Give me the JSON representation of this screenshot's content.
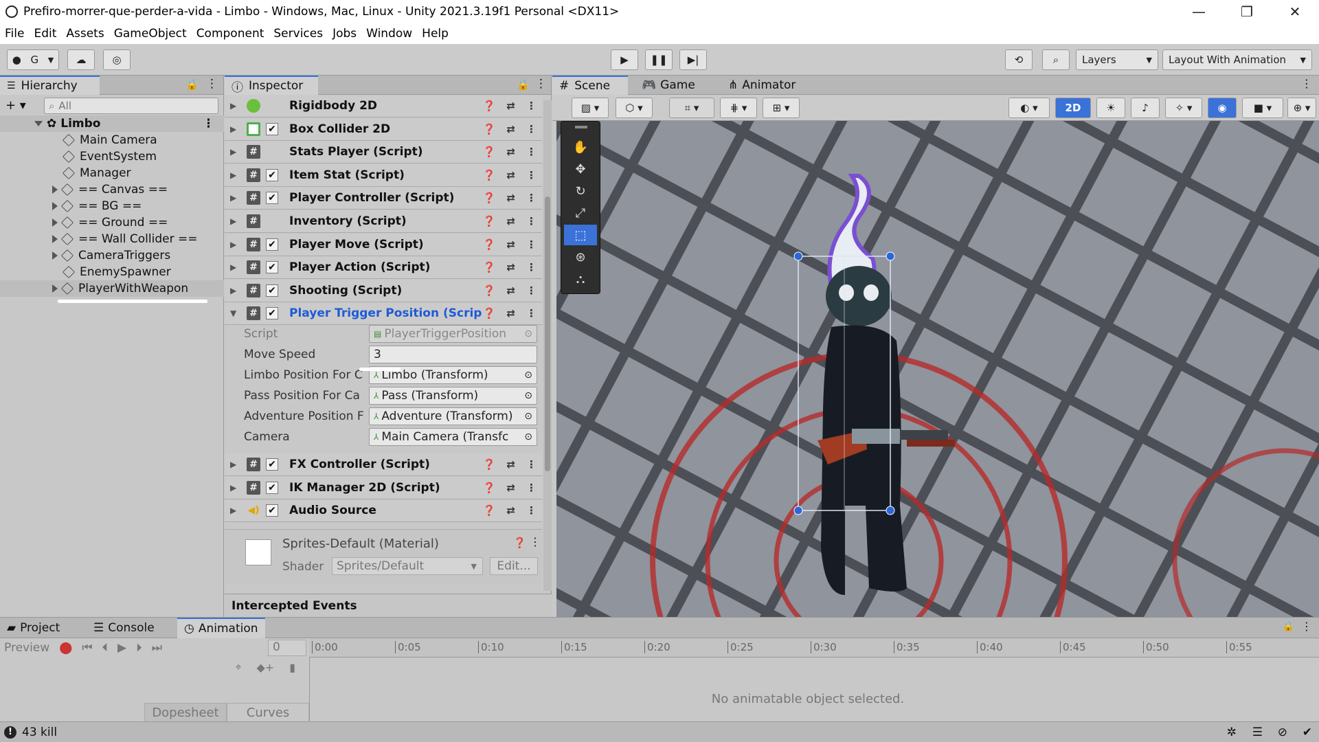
{
  "window": {
    "title": "Prefiro-morrer-que-perder-a-vida - Limbo - Windows, Mac, Linux - Unity 2021.3.19f1 Personal <DX11>",
    "controls": [
      "—",
      "❐",
      "✕"
    ]
  },
  "menu": [
    "File",
    "Edit",
    "Assets",
    "GameObject",
    "Component",
    "Services",
    "Jobs",
    "Window",
    "Help"
  ],
  "toolbar": {
    "account_label": "G",
    "layers_label": "Layers",
    "layout_label": "Layout With Animation"
  },
  "hierarchy": {
    "tab": "Hierarchy",
    "search_placeholder": "All",
    "scene": "Limbo",
    "items": [
      {
        "label": "Main Camera",
        "expand": false
      },
      {
        "label": "EventSystem",
        "expand": false
      },
      {
        "label": "Manager",
        "expand": false
      },
      {
        "label": "== Canvas ==",
        "expand": true
      },
      {
        "label": "== BG ==",
        "expand": true
      },
      {
        "label": "== Ground ==",
        "expand": true
      },
      {
        "label": "== Wall Collider ==",
        "expand": true
      },
      {
        "label": "CameraTriggers",
        "expand": true
      },
      {
        "label": "EnemySpawner",
        "expand": false
      },
      {
        "label": "PlayerWithWeapon",
        "expand": true
      }
    ]
  },
  "inspector": {
    "tab": "Inspector",
    "components": [
      {
        "name": "Rigidbody 2D",
        "icon": "rigidbody-icon",
        "checkbox": false
      },
      {
        "name": "Box Collider 2D",
        "icon": "box-collider-icon",
        "checkbox": true
      },
      {
        "name": "Stats Player (Script)",
        "icon": "script-icon",
        "checkbox": false
      },
      {
        "name": "Item Stat (Script)",
        "icon": "script-icon",
        "checkbox": true
      },
      {
        "name": "Player Controller (Script)",
        "icon": "script-icon",
        "checkbox": true
      },
      {
        "name": "Inventory (Script)",
        "icon": "script-icon",
        "checkbox": false
      },
      {
        "name": "Player Move (Script)",
        "icon": "script-icon",
        "checkbox": true
      },
      {
        "name": "Player Action (Script)",
        "icon": "script-icon",
        "checkbox": true
      },
      {
        "name": "Shooting (Script)",
        "icon": "script-icon",
        "checkbox": true
      },
      {
        "name": "Player Trigger Position (Scrip",
        "icon": "script-icon",
        "checkbox": true
      }
    ],
    "expanded_props": [
      {
        "label": "Script",
        "value": "PlayerTriggerPosition"
      },
      {
        "label": "Move Speed",
        "value": "3"
      },
      {
        "label": "Limbo Position For C",
        "value": "Limbo (Transform)"
      },
      {
        "label": "Pass Position For Ca",
        "value": "Pass (Transform)"
      },
      {
        "label": "Adventure Position F",
        "value": "Adventure (Transform)"
      },
      {
        "label": "Camera",
        "value": "Main Camera (Transfc"
      }
    ],
    "components_after": [
      {
        "name": "FX Controller (Script)",
        "icon": "script-icon"
      },
      {
        "name": "IK Manager 2D (Script)",
        "icon": "script-icon"
      },
      {
        "name": "Audio Source",
        "icon": "audio-source-icon"
      }
    ],
    "material": {
      "name": "Sprites-Default (Material)",
      "shader_label": "Shader",
      "shader_value": "Sprites/Default",
      "edit_label": "Edit..."
    },
    "intercepted_events": "Intercepted Events"
  },
  "scene": {
    "tabs": [
      "Scene",
      "Game",
      "Animator"
    ],
    "mode_2d": "2D"
  },
  "animation": {
    "tabs": [
      "Project",
      "Console",
      "Animation"
    ],
    "preview_label": "Preview",
    "frame_value": "0",
    "timeline_ticks": [
      "0:00",
      "0:05",
      "0:10",
      "0:15",
      "0:20",
      "0:25",
      "0:30",
      "0:35",
      "0:40",
      "0:45",
      "0:50",
      "0:55"
    ],
    "empty_message": "No animatable object selected.",
    "dopesheet_label": "Dopesheet",
    "curves_label": "Curves"
  },
  "status": {
    "message": "43 kill"
  },
  "colors": {
    "accent": "#3a72d8",
    "selected_text": "#1e5bd6"
  }
}
